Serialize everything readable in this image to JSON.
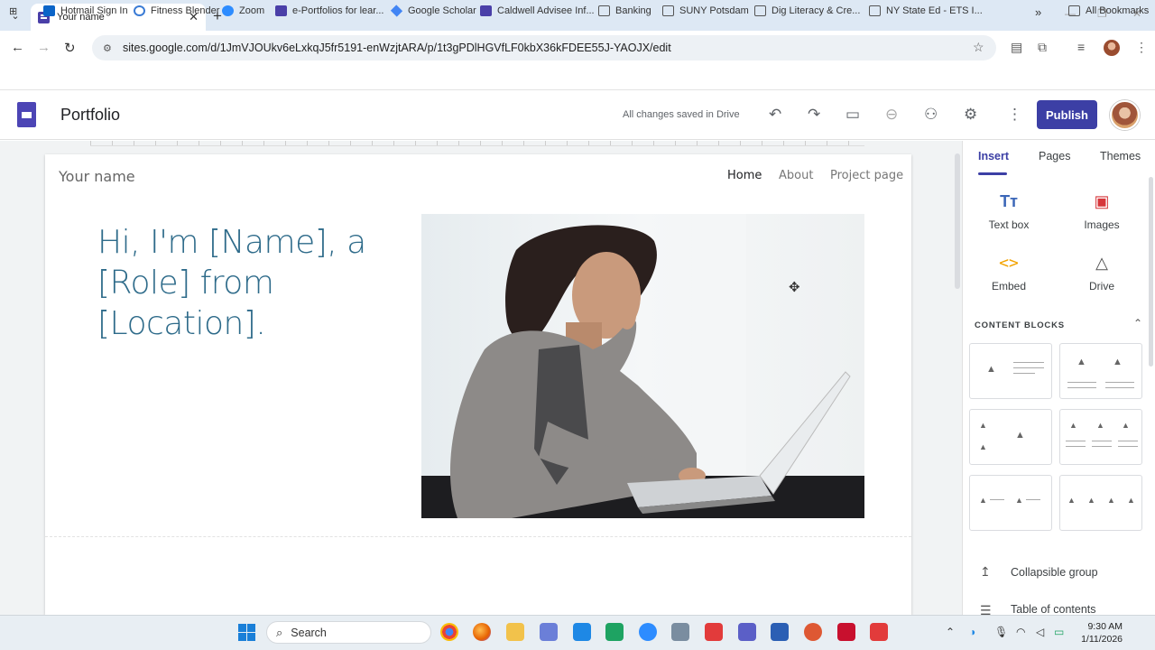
{
  "browser": {
    "tab_title": "Your name",
    "tab_close": "✕",
    "new_tab": "+",
    "url": "sites.google.com/d/1JmVJOUkv6eLxkqJ5fr5191-enWzjtARA/p/1t3gPDlHGVfLF0kbX36kFDEE55J-YAOJX/edit",
    "bookmarks": [
      {
        "label": "Hotmail Sign In",
        "icon": "outlook-icon"
      },
      {
        "label": "Fitness Blender",
        "icon": "fitness-icon"
      },
      {
        "label": "Zoom",
        "icon": "zoom-icon"
      },
      {
        "label": "e-Portfolios for lear...",
        "icon": "sites-icon"
      },
      {
        "label": "Google Scholar",
        "icon": "scholar-icon"
      },
      {
        "label": "Caldwell Advisee Inf...",
        "icon": "sites-icon"
      },
      {
        "label": "Banking",
        "icon": "folder-icon"
      },
      {
        "label": "SUNY Potsdam",
        "icon": "folder-icon"
      },
      {
        "label": "Dig Literacy & Cre...",
        "icon": "folder-icon"
      },
      {
        "label": "NY State Ed - ETS I...",
        "icon": "folder-icon"
      }
    ],
    "bookmarks_more": "»",
    "all_bookmarks": "All Bookmarks"
  },
  "app": {
    "title": "Portfolio",
    "save_status": "All changes saved in Drive",
    "publish_label": "Publish"
  },
  "site": {
    "name": "Your name",
    "nav": [
      "Home",
      "About",
      "Project page"
    ],
    "hero_text": "Hi, I'm [Name], a [Role] from [Location]."
  },
  "panel": {
    "tabs": [
      "Insert",
      "Pages",
      "Themes"
    ],
    "insert_items": [
      {
        "label": "Text box",
        "icon": "text-box-icon"
      },
      {
        "label": "Images",
        "icon": "image-icon"
      },
      {
        "label": "Embed",
        "icon": "embed-icon"
      },
      {
        "label": "Drive",
        "icon": "drive-icon"
      }
    ],
    "content_blocks_heading": "CONTENT BLOCKS",
    "list_items": [
      "Collapsible group",
      "Table of contents"
    ]
  },
  "taskbar": {
    "search_placeholder": "Search",
    "time": "9:30 AM",
    "date": "1/11/2026"
  },
  "colors": {
    "accent": "#3c3fa5",
    "hero_text": "#2e6b8a"
  }
}
